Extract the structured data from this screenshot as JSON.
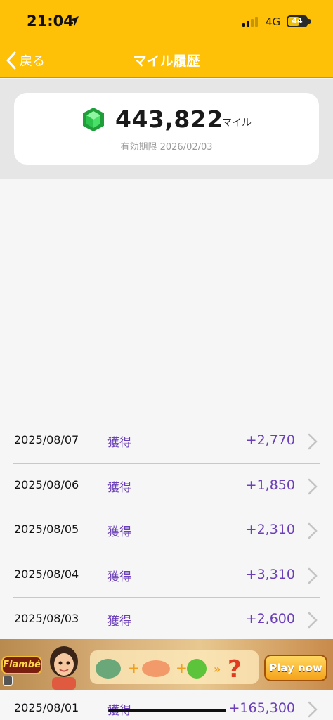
{
  "status_bar": {
    "time": "21:04",
    "network": "4G",
    "battery": "44"
  },
  "nav": {
    "back_label": "戻る",
    "title": "マイル履歴"
  },
  "summary": {
    "total": "443,822",
    "unit": "マイル",
    "expiry": "有効期限 2026/02/03"
  },
  "history": [
    {
      "date": "2025/08/07",
      "type": "獲得",
      "amount": "+2,770"
    },
    {
      "date": "2025/08/06",
      "type": "獲得",
      "amount": "+1,850"
    },
    {
      "date": "2025/08/05",
      "type": "獲得",
      "amount": "+2,310"
    },
    {
      "date": "2025/08/04",
      "type": "獲得",
      "amount": "+3,310"
    },
    {
      "date": "2025/08/03",
      "type": "獲得",
      "amount": "+2,600"
    }
  ],
  "last_row": {
    "date": "2025/08/01",
    "type": "獲得",
    "amount": "+165,300"
  },
  "ad": {
    "logo_text": "Flambé",
    "cta_label": "Play now"
  },
  "colors": {
    "header": "#ffc008",
    "accent": "#6a3fb8",
    "gem": "#2ec84a"
  },
  "icons": {
    "back": "chevron-left-icon",
    "row": "chevron-right-icon",
    "gem": "gem-icon",
    "location": "location-arrow-icon",
    "signal": "signal-bars-icon",
    "battery": "battery-icon"
  }
}
